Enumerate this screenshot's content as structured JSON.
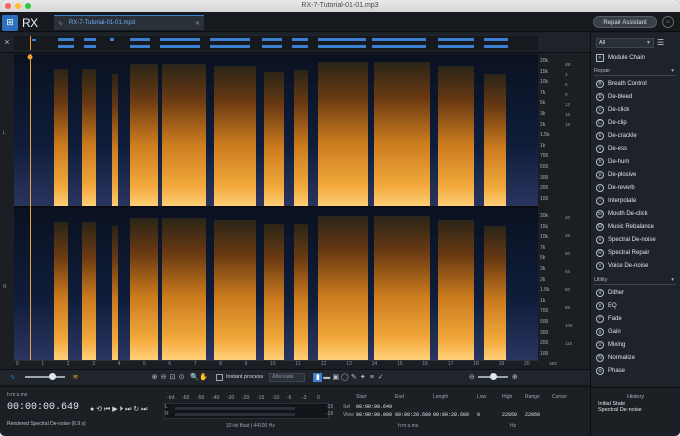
{
  "window": {
    "title": "RX-7-Tutorial-01-01.mp3"
  },
  "app": {
    "logo_text": "RX",
    "tab_label": "RX-7-Tutorial-01-01.mp3",
    "repair_assistant_label": "Repair Assistant"
  },
  "spectrogram": {
    "freq_labels": [
      "20k",
      "15k",
      "10k",
      "7k",
      "5k",
      "3k",
      "2k",
      "1.5k",
      "1k",
      "700",
      "500",
      "300",
      "200",
      "100"
    ],
    "freq_labels_lower": [
      "20k",
      "15k",
      "10k",
      "7k",
      "5k",
      "3k",
      "2k",
      "1.5k",
      "1k",
      "700",
      "500",
      "300",
      "200",
      "100"
    ],
    "db_labels": [
      "dB",
      "3",
      "6",
      "9",
      "12",
      "15",
      "18",
      "20",
      "35",
      "50",
      "65",
      "80",
      "95",
      "105",
      "115"
    ],
    "lane_left": "L",
    "lane_right": "R",
    "time_labels": [
      "0",
      "1",
      "2",
      "3",
      "4",
      "5",
      "6",
      "7",
      "8",
      "9",
      "10",
      "11",
      "12",
      "13",
      "14",
      "15",
      "16",
      "17",
      "18",
      "19",
      "20",
      "sec"
    ]
  },
  "toolbar": {
    "instant_process_label": "Instant process",
    "attenuate_value": "Attenuate"
  },
  "transport": {
    "format_label": "h:m:s.ms",
    "time": "00:00:00.649",
    "status": "Rendered Spectral De-noise (6.9 s)",
    "meter_ticks": [
      "-Inf.",
      "-60",
      "-50",
      "-40",
      "-30",
      "-20",
      "-15",
      "-10",
      "-6",
      "-3",
      "0"
    ],
    "meter_L": "L",
    "meter_R": "R",
    "meter_peak_top": "-15",
    "meter_peak_bottom": "-16",
    "format_info": "32-bit float | 44100 Hz"
  },
  "selection": {
    "sel_label": "Sel",
    "view_label": "View",
    "start_label": "Start",
    "end_label": "End",
    "length_label": "Length",
    "low_label": "Low",
    "high_label": "High",
    "range_label": "Range",
    "cursor_label": "Cursor",
    "sel_start": "00:00:00.649",
    "view_start": "00:00:00.000",
    "view_end": "00:00:20.689",
    "view_length": "00:00:20.689",
    "low": "0",
    "high": "22050",
    "range": "22050",
    "hms_label": "h:m:s.ms",
    "hz_label": "Hz"
  },
  "panel": {
    "filter_value": "All",
    "module_chain": "Module Chain",
    "repair_section": "Repair",
    "repair_modules": [
      {
        "label": "Breath Control",
        "icon": "B"
      },
      {
        "label": "De-bleed",
        "icon": "b"
      },
      {
        "label": "De-click",
        "icon": "c"
      },
      {
        "label": "De-clip",
        "icon": "C"
      },
      {
        "label": "De-crackle",
        "icon": "k"
      },
      {
        "label": "De-ess",
        "icon": "s"
      },
      {
        "label": "De-hum",
        "icon": "h"
      },
      {
        "label": "De-plosive",
        "icon": "p"
      },
      {
        "label": "De-reverb",
        "icon": "r"
      },
      {
        "label": "Interpolate",
        "icon": "i"
      },
      {
        "label": "Mouth De-click",
        "icon": "m"
      },
      {
        "label": "Music Rebalance",
        "icon": "M"
      },
      {
        "label": "Spectral De-noise",
        "icon": "n"
      },
      {
        "label": "Spectral Repair",
        "icon": "R"
      },
      {
        "label": "Voice De-noise",
        "icon": "v"
      }
    ],
    "utility_section": "Utility",
    "utility_modules": [
      {
        "label": "Dither",
        "icon": "d"
      },
      {
        "label": "EQ",
        "icon": "e"
      },
      {
        "label": "Fade",
        "icon": "f"
      },
      {
        "label": "Gain",
        "icon": "g"
      },
      {
        "label": "Mixing",
        "icon": "x"
      },
      {
        "label": "Normalize",
        "icon": "N"
      },
      {
        "label": "Phase",
        "icon": "φ"
      }
    ]
  },
  "history": {
    "title": "History",
    "items": [
      "Initial State",
      "Spectral De-noise"
    ]
  },
  "colors": {
    "accent": "#3b7fd0",
    "spectro_hot": "#f0a030",
    "spectro_cold": "#0b1426"
  }
}
